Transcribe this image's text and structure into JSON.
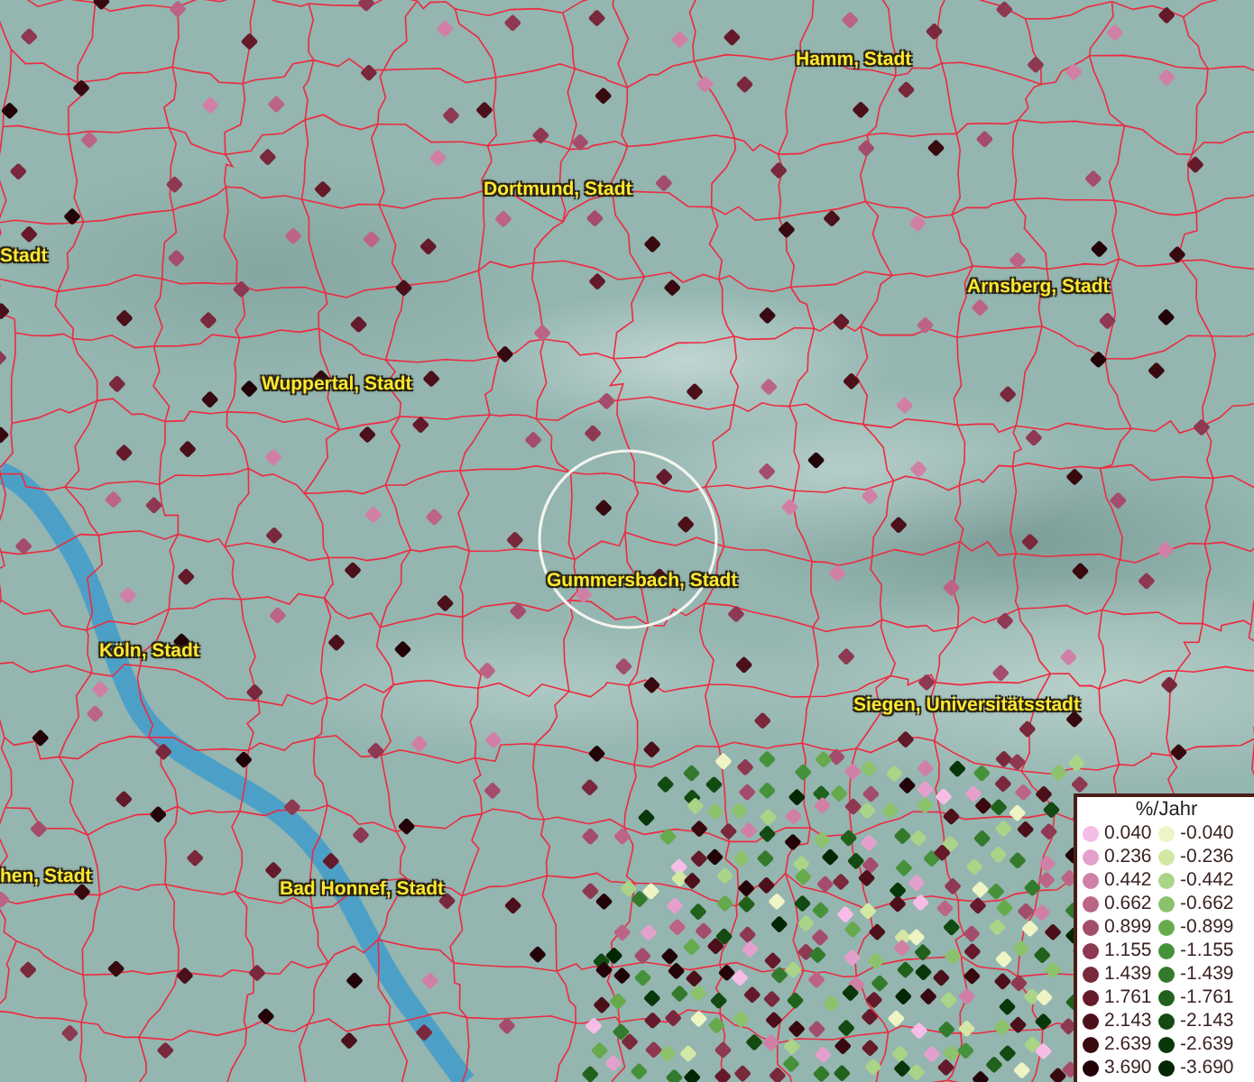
{
  "map": {
    "places": [
      {
        "name": "Hamm, Stadt"
      },
      {
        "name": "Dortmund, Stadt"
      },
      {
        "name": "Stadt"
      },
      {
        "name": "Arnsberg, Stadt"
      },
      {
        "name": "Wuppertal, Stadt"
      },
      {
        "name": "Gummersbach, Stadt"
      },
      {
        "name": "Köln, Stadt"
      },
      {
        "name": "Siegen, Universitätsstadt"
      },
      {
        "name": "hen, Stadt"
      },
      {
        "name": "Bad Honnef, Stadt"
      }
    ]
  },
  "legend": {
    "title": "%/Jahr",
    "rows": [
      {
        "positive": {
          "label": "0.040",
          "color": "#f6bde6"
        },
        "negative": {
          "label": "-0.040",
          "color": "#eef4c4"
        }
      },
      {
        "positive": {
          "label": "0.236",
          "color": "#e4a0cc"
        },
        "negative": {
          "label": "-0.236",
          "color": "#d2e8a4"
        }
      },
      {
        "positive": {
          "label": "0.442",
          "color": "#d080a6"
        },
        "negative": {
          "label": "-0.442",
          "color": "#aad488"
        }
      },
      {
        "positive": {
          "label": "0.662",
          "color": "#bc6486"
        },
        "negative": {
          "label": "-0.662",
          "color": "#8cc26c"
        }
      },
      {
        "positive": {
          "label": "0.899",
          "color": "#a44c6c"
        },
        "negative": {
          "label": "-0.899",
          "color": "#66aa4c"
        }
      },
      {
        "positive": {
          "label": "1.155",
          "color": "#8e3852"
        },
        "negative": {
          "label": "-1.155",
          "color": "#46923a"
        }
      },
      {
        "positive": {
          "label": "1.439",
          "color": "#7a283c"
        },
        "negative": {
          "label": "-1.439",
          "color": "#347a2c"
        }
      },
      {
        "positive": {
          "label": "1.761",
          "color": "#641a2a"
        },
        "negative": {
          "label": "-1.761",
          "color": "#20621c"
        }
      },
      {
        "positive": {
          "label": "2.143",
          "color": "#4c101a"
        },
        "negative": {
          "label": "-2.143",
          "color": "#124a12"
        }
      },
      {
        "positive": {
          "label": "2.639",
          "color": "#380a10"
        },
        "negative": {
          "label": "-2.639",
          "color": "#08380a"
        }
      },
      {
        "positive": {
          "label": "3.690",
          "color": "#220408"
        },
        "negative": {
          "label": "-3.690",
          "color": "#042604"
        }
      }
    ]
  }
}
